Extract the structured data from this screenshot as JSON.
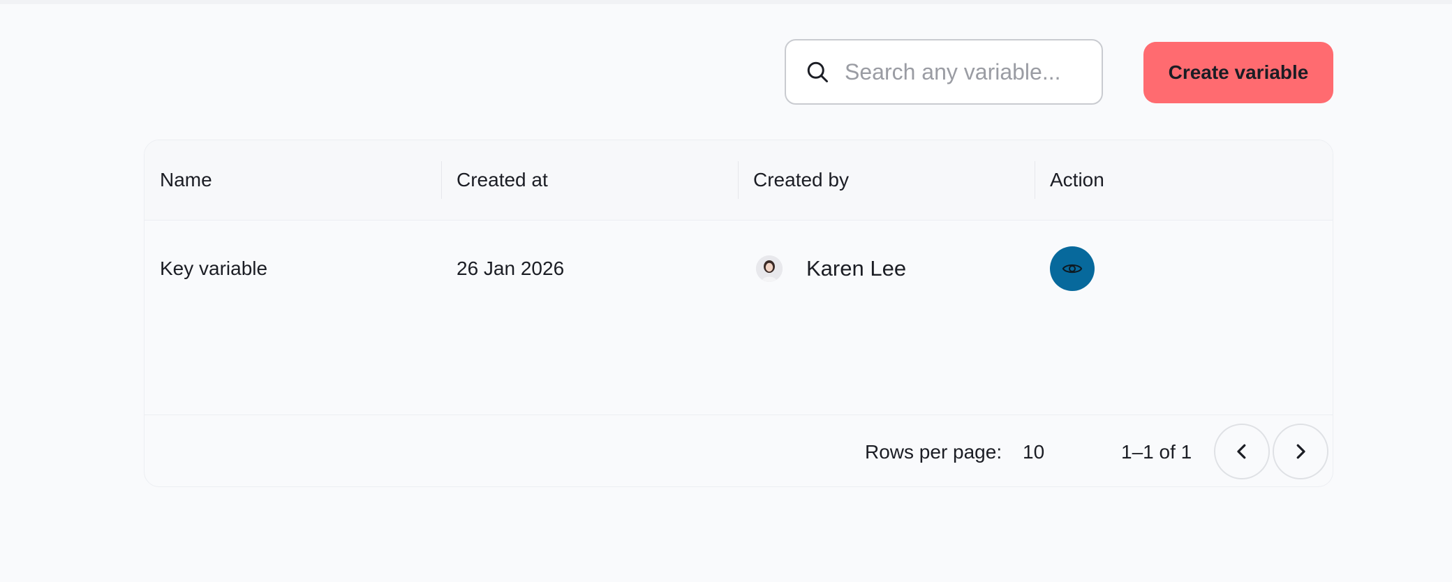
{
  "toolbar": {
    "search_placeholder": "Search any variable...",
    "search_value": "",
    "create_label": "Create variable"
  },
  "table": {
    "columns": [
      "Name",
      "Created at",
      "Created by",
      "Action"
    ],
    "rows": [
      {
        "name": "Key variable",
        "created_at": "26 Jan 2026",
        "created_by": "Karen Lee",
        "action_icon": "eye-icon"
      }
    ]
  },
  "pagination": {
    "rows_per_page_label": "Rows per page:",
    "rows_per_page_value": "10",
    "range_text": "1–1 of 1",
    "prev_icon": "chevron-left-icon",
    "next_icon": "chevron-right-icon"
  },
  "colors": {
    "accent": "#ff6b70",
    "action": "#07699c",
    "background": "#f9fafc"
  }
}
